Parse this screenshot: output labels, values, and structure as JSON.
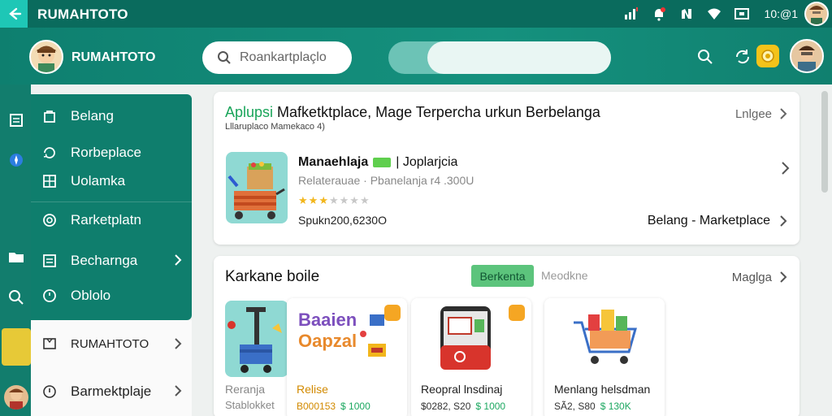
{
  "status_bar": {
    "title": "RUMAHTOTO",
    "time": "10:@1"
  },
  "header": {
    "title": "RUMAHTOTO",
    "search_placeholder": "Roankartplaçlo"
  },
  "drawer": {
    "items": [
      {
        "label": "Belang",
        "icon": "bag-icon"
      },
      {
        "label": "Rorbeplace",
        "icon": "refresh-icon"
      },
      {
        "label": "Uolamka",
        "icon": "grid-icon"
      },
      {
        "label": "Rarketplatn",
        "icon": "target-icon"
      },
      {
        "label": "Becharnga",
        "icon": "list-icon"
      },
      {
        "label": "Oblolo",
        "icon": "clock-icon"
      },
      {
        "label": "RUMAHTOTO",
        "icon": "tag-icon"
      },
      {
        "label": "Barmektplaje",
        "icon": "info-icon"
      }
    ]
  },
  "card_featured": {
    "title_green": "Aplupsi",
    "title_rest": " Mafketktplace, Mage Terpercha urkun Berbelanga",
    "subtitle": "Lllaruplaco Mamekaco 4)",
    "link": "Lnlgee",
    "product": {
      "name": "Manaehlaja",
      "name_suffix": "| Joplarjcia",
      "desc": "Relaterauae · Pbanelanja r4 .300U",
      "rating": 3,
      "price": "Spukn200,6230O"
    },
    "footer_link": "Belang - Marketplace"
  },
  "card_list": {
    "title": "Karkane boile",
    "tab_active": "Berkenta",
    "tab_inactive": "Meodkne",
    "link": "Maglga",
    "tiles": [
      {
        "name": "Reranja",
        "sub": "Stablokket"
      },
      {
        "name": "Relise",
        "price": "B000153",
        "price2": "$ 1000",
        "image_text_1": "Baaien",
        "image_text_2": "Oapzal"
      },
      {
        "name": "Reopral lnsdinaj",
        "price": "$0282, S20",
        "price2": "$ 1000"
      },
      {
        "name": "Menlang helsdman",
        "price": "SÃ2, S80",
        "price2": "$ 130K"
      }
    ]
  },
  "colors": {
    "primary": "#0f7e6d",
    "accent": "#1ec7b6",
    "green": "#5cc47c",
    "star": "#f2b61c"
  }
}
